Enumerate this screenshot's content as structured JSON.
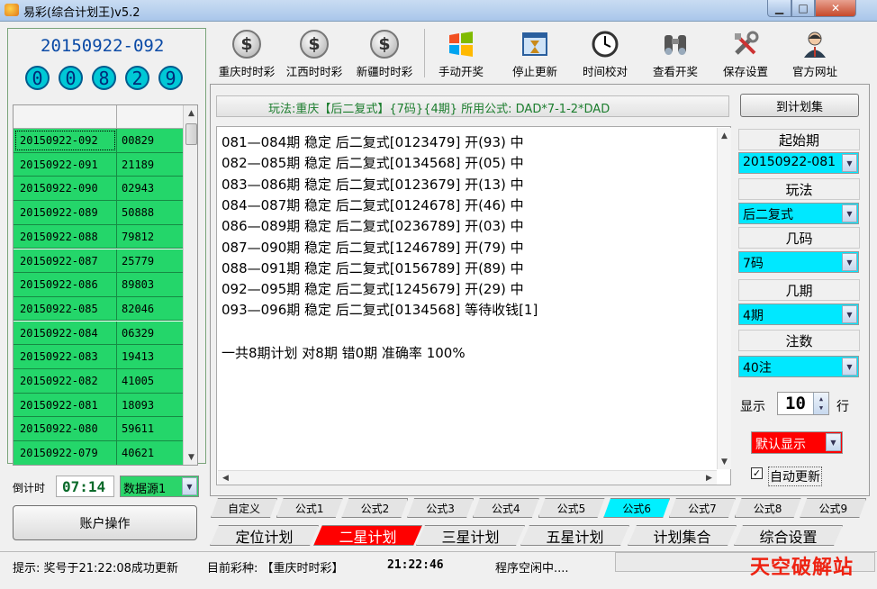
{
  "window": {
    "title": "易彩(综合计划王)v5.2"
  },
  "left": {
    "current_issue": "20150922-092",
    "numbers": [
      "0",
      "0",
      "8",
      "2",
      "9"
    ],
    "history": [
      {
        "issue": "20150922-092",
        "code": "00829"
      },
      {
        "issue": "20150922-091",
        "code": "21189"
      },
      {
        "issue": "20150922-090",
        "code": "02943"
      },
      {
        "issue": "20150922-089",
        "code": "50888"
      },
      {
        "issue": "20150922-088",
        "code": "79812"
      },
      {
        "issue": "20150922-087",
        "code": "25779"
      },
      {
        "issue": "20150922-086",
        "code": "89803"
      },
      {
        "issue": "20150922-085",
        "code": "82046"
      },
      {
        "issue": "20150922-084",
        "code": "06329"
      },
      {
        "issue": "20150922-083",
        "code": "19413"
      },
      {
        "issue": "20150922-082",
        "code": "41005"
      },
      {
        "issue": "20150922-081",
        "code": "18093"
      },
      {
        "issue": "20150922-080",
        "code": "59611"
      },
      {
        "issue": "20150922-079",
        "code": "40621"
      }
    ],
    "countdown_label": "倒计时",
    "countdown": "07:14",
    "source": "数据源1",
    "account_button": "账户操作"
  },
  "toolbar": [
    {
      "label": "重庆时时彩",
      "icon": "dollar-coin-icon"
    },
    {
      "label": "江西时时彩",
      "icon": "dollar-coin-icon"
    },
    {
      "label": "新疆时时彩",
      "icon": "dollar-coin-icon"
    },
    {
      "label": "手动开奖",
      "icon": "windows-flag-icon"
    },
    {
      "label": "停止更新",
      "icon": "hourglass-window-icon"
    },
    {
      "label": "时间校对",
      "icon": "clock-icon"
    },
    {
      "label": "查看开奖",
      "icon": "binoculars-icon"
    },
    {
      "label": "保存设置",
      "icon": "tools-icon"
    },
    {
      "label": "官方网址",
      "icon": "person-icon"
    }
  ],
  "main": {
    "play_info": "玩法:重庆【后二复式】{7码}{4期} 所用公式: DAD*7-1-2*DAD",
    "to_set_button": "到计划集",
    "results": [
      "081—084期 稳定 后二复式[0123479] 开(93) 中",
      "082—085期 稳定 后二复式[0134568] 开(05) 中",
      "083—086期 稳定 后二复式[0123679] 开(13) 中",
      "084—087期 稳定 后二复式[0124678] 开(46) 中",
      "086—089期 稳定 后二复式[0236789] 开(03) 中",
      "087—090期 稳定 后二复式[1246789] 开(79) 中",
      "088—091期 稳定 后二复式[0156789] 开(89) 中",
      "092—095期 稳定 后二复式[1245679] 开(29) 中",
      "093—096期 稳定 后二复式[0134568] 等待收钱[1]"
    ],
    "summary": "一共8期计划 对8期 错0期 准确率 100%"
  },
  "controls": {
    "start_label": "起始期",
    "start_value": "20150922-081",
    "play_label": "玩法",
    "play_value": "后二复式",
    "codes_label": "几码",
    "codes_value": "7码",
    "periods_label": "几期",
    "periods_value": "4期",
    "bets_label": "注数",
    "bets_value": "40注",
    "show_label": "显示",
    "show_value": "10",
    "row_label": "行",
    "display_mode": "默认显示",
    "auto_update_label": "自动更新",
    "auto_update_checked": true
  },
  "formula_tabs": [
    "自定义",
    "公式1",
    "公式2",
    "公式3",
    "公式4",
    "公式5",
    "公式6",
    "公式7",
    "公式8",
    "公式9"
  ],
  "formula_tab_active": 6,
  "main_tabs": [
    "定位计划",
    "二星计划",
    "三星计划",
    "五星计划",
    "计划集合",
    "综合设置"
  ],
  "main_tab_active": 1,
  "status": {
    "hint": "提示: 奖号于21:22:08成功更新",
    "lottery": "目前彩种: 【重庆时时彩】",
    "time": "21:22:46",
    "state": "程序空闲中....",
    "watermark": "天空破解站"
  },
  "colors": {
    "history_row": "#24d66a",
    "select_bg": "#00e8ff",
    "active_main_tab": "#ff0000",
    "active_formula_tab": "#00f0ff",
    "play_info_text": "#1b7d2d"
  }
}
